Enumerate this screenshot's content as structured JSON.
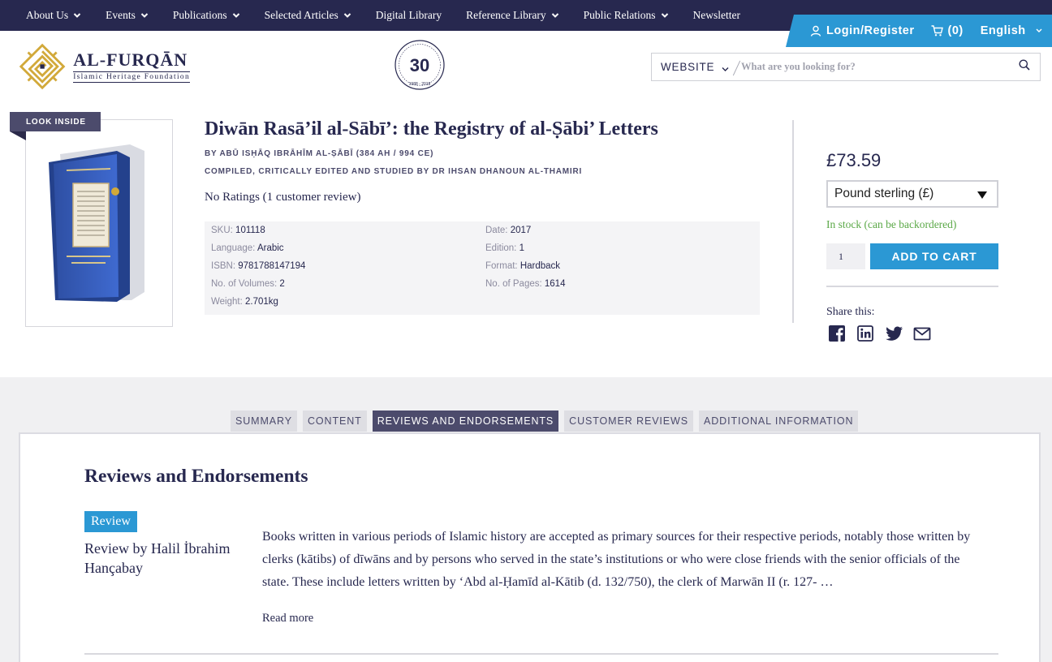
{
  "nav": {
    "items": [
      {
        "label": "About Us",
        "has_dropdown": true
      },
      {
        "label": "Events",
        "has_dropdown": true
      },
      {
        "label": "Publications",
        "has_dropdown": true
      },
      {
        "label": "Selected Articles",
        "has_dropdown": true
      },
      {
        "label": "Digital Library",
        "has_dropdown": false
      },
      {
        "label": "Reference Library",
        "has_dropdown": true
      },
      {
        "label": "Public Relations",
        "has_dropdown": true
      },
      {
        "label": "Newsletter",
        "has_dropdown": false
      }
    ]
  },
  "account": {
    "login_label": "Login/Register",
    "cart_count": "(0)",
    "language": "English"
  },
  "brand": {
    "name": "AL-FURQĀN",
    "subtitle": "Islamic Heritage Foundation",
    "anniversary_number": "30",
    "anniversary_years": "1988 - 2018"
  },
  "search": {
    "scope": "WEBSITE",
    "placeholder": "What are you looking for?"
  },
  "product": {
    "look_inside_label": "LOOK INSIDE",
    "title": "Diwān Rasā’il al-Sābī’: the Registry of al-Ṣābi’ Letters",
    "author": "BY ABŪ ISḤĀQ IBRĀHĪM AL-ṢĀBĪ (384 AH / 994 CE)",
    "editor": "COMPILED, CRITICALLY EDITED AND STUDIED BY DR IHSAN DHANOUN AL-THAMIRI",
    "ratings": "No Ratings (1 customer review)",
    "specs": {
      "sku": {
        "label": "SKU:",
        "value": "101118"
      },
      "language": {
        "label": "Language:",
        "value": "Arabic"
      },
      "isbn": {
        "label": "ISBN:",
        "value": "9781788147194"
      },
      "volumes": {
        "label": "No. of Volumes:",
        "value": "2"
      },
      "weight": {
        "label": "Weight:",
        "value": "2.701kg"
      },
      "date": {
        "label": "Date:",
        "value": "2017"
      },
      "edition": {
        "label": "Edition:",
        "value": "1"
      },
      "format": {
        "label": "Format:",
        "value": "Hardback"
      },
      "pages": {
        "label": "No. of Pages:",
        "value": "1614"
      }
    }
  },
  "purchase": {
    "price": "£73.59",
    "currency": "Pound sterling (£)",
    "stock": "In stock (can be backordered)",
    "quantity": "1",
    "add_to_cart_label": "ADD TO CART",
    "share_label": "Share this:",
    "share_icons": [
      "facebook-icon",
      "linkedin-icon",
      "twitter-icon",
      "email-icon"
    ]
  },
  "tabs": [
    {
      "label": "SUMMARY",
      "active": false
    },
    {
      "label": "CONTENT",
      "active": false
    },
    {
      "label": "REVIEWS AND ENDORSEMENTS",
      "active": true
    },
    {
      "label": "CUSTOMER REVIEWS",
      "active": false
    },
    {
      "label": "ADDITIONAL INFORMATION",
      "active": false
    }
  ],
  "reviews": {
    "section_title": "Reviews and Endorsements",
    "badge": "Review",
    "reviewer": "Review by Halil İbrahim Hançabay",
    "text": "Books written in various periods of Islamic history are accepted as primary sources for their respective periods, notably those written by clerks (kātibs) of dīwāns and by persons who served in the state’s institutions or who were close friends with the senior officials of the state. These include letters written by ‘Abd al-Ḥamīd al-Kātib (d. 132/750), the clerk of Marwān II (r. 127- …",
    "read_more_label": "Read more"
  },
  "colors": {
    "navy": "#27284f",
    "accent_blue": "#2b98d4",
    "tab_active": "#4c4b6c",
    "in_stock_green": "#5aa846",
    "logo_gold": "#d2a93a"
  }
}
